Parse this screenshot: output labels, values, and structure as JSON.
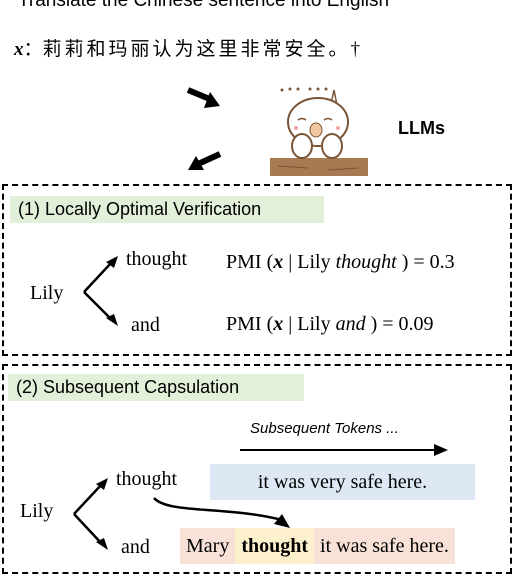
{
  "header": {
    "instruction": "Translate the Chinese sentence into English",
    "source_var": "x",
    "source_sep": "：",
    "source_sentence": "莉莉和玛丽认为这里非常安全。",
    "dagger": "†"
  },
  "model": {
    "label": "LLMs",
    "icon": "alpaca-mascot-icon"
  },
  "section1": {
    "title": "(1) Locally Optimal Verification",
    "root": "Lily",
    "branches": [
      {
        "token": "thought",
        "pmi_prefix": "PMI (",
        "pmi_var": "x",
        "pmi_bar": " | Lily ",
        "pmi_token": "thought",
        "pmi_suffix": " ) = 0.3",
        "value": 0.3
      },
      {
        "token": "and",
        "pmi_prefix": "PMI (",
        "pmi_var": "x",
        "pmi_bar": " | Lily ",
        "pmi_token": "and",
        "pmi_suffix": " )  = 0.09",
        "value": 0.09
      }
    ]
  },
  "section2": {
    "title": "(2) Subsequent Capsulation",
    "root": "Lily",
    "subsequent_label": "Subsequent Tokens ...",
    "branches": [
      {
        "token": "thought",
        "continuation": "it was very safe here."
      },
      {
        "token": "and",
        "continuation_parts": [
          "Mary",
          "thought",
          "it was safe here."
        ]
      }
    ]
  },
  "colors": {
    "tag_bg": "#e2efd9",
    "blue_bg": "#dde8f4",
    "pink_bg": "#f8e2d8",
    "yellow_bg": "#fdf0cd"
  }
}
